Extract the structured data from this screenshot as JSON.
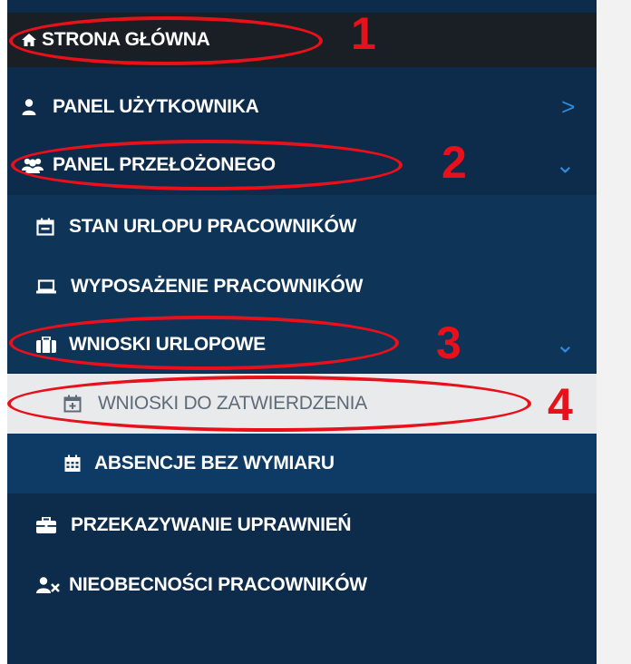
{
  "menu": {
    "home": {
      "label": "STRONA GŁÓWNA",
      "icon": "home-icon"
    },
    "user_panel": {
      "label": "PANEL UŻYTKOWNIKA",
      "icon": "user-icon",
      "chevron": ">"
    },
    "supervisor_panel": {
      "label": "PANEL PRZEŁOŻONEGO",
      "icon": "users-icon",
      "chevron": "⌄"
    },
    "leave_status": {
      "label": "STAN URLOPU PRACOWNIKÓW",
      "icon": "calendar-icon"
    },
    "equipment": {
      "label": "WYPOSAŻENIE PRACOWNIKÓW",
      "icon": "laptop-icon"
    },
    "leave_requests": {
      "label": "WNIOSKI URLOPOWE",
      "icon": "suitcase-icon",
      "chevron": "⌄"
    },
    "pending_requests": {
      "label": "WNIOSKI DO ZATWIERDZENIA",
      "icon": "calendar-plus-icon"
    },
    "absences": {
      "label": "ABSENCJE BEZ WYMIARU",
      "icon": "calendar-grid-icon"
    },
    "permissions": {
      "label": "PRZEKAZYWANIE UPRAWNIEŃ",
      "icon": "briefcase-icon"
    },
    "employee_absences": {
      "label": "NIEOBECNOŚCI PRACOWNIKÓW",
      "icon": "user-times-icon"
    }
  },
  "annotations": {
    "n1": "1",
    "n2": "2",
    "n3": "3",
    "n4": "4"
  },
  "colors": {
    "sidebar": "#0d2b4a",
    "annotation": "#e8101a",
    "chevron": "#2f8bdc",
    "selected_bg": "#e8eaec"
  }
}
